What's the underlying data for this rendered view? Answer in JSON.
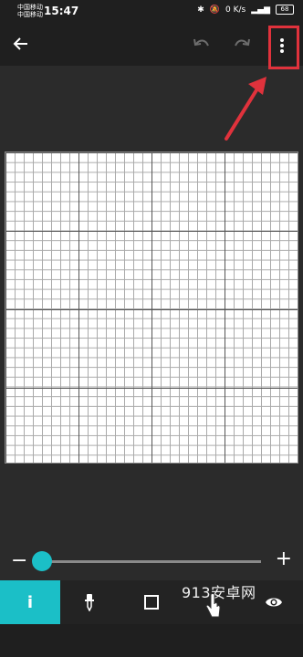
{
  "status": {
    "carrier_line1": "中国移动",
    "carrier_line2": "中国移动",
    "time": "15:47",
    "net_speed": "0 K/s",
    "battery": "68"
  },
  "toolbar": {
    "back_icon": "arrow-left-icon",
    "undo_icon": "undo-icon",
    "redo_icon": "redo-icon",
    "menu_icon": "more-vertical-icon"
  },
  "annotation": {
    "highlight_color": "#e0323c"
  },
  "zoom": {
    "minus_label": "−",
    "plus_label": "+",
    "level": 0.0
  },
  "tools": {
    "info_label": "i",
    "picker_icon": "eyedropper-icon",
    "square_icon": "square-icon",
    "eye_icon": "eye-icon"
  },
  "watermark": {
    "text": "913安卓网"
  },
  "colors": {
    "accent": "#1bbfc7",
    "background": "#2b2b2b"
  }
}
